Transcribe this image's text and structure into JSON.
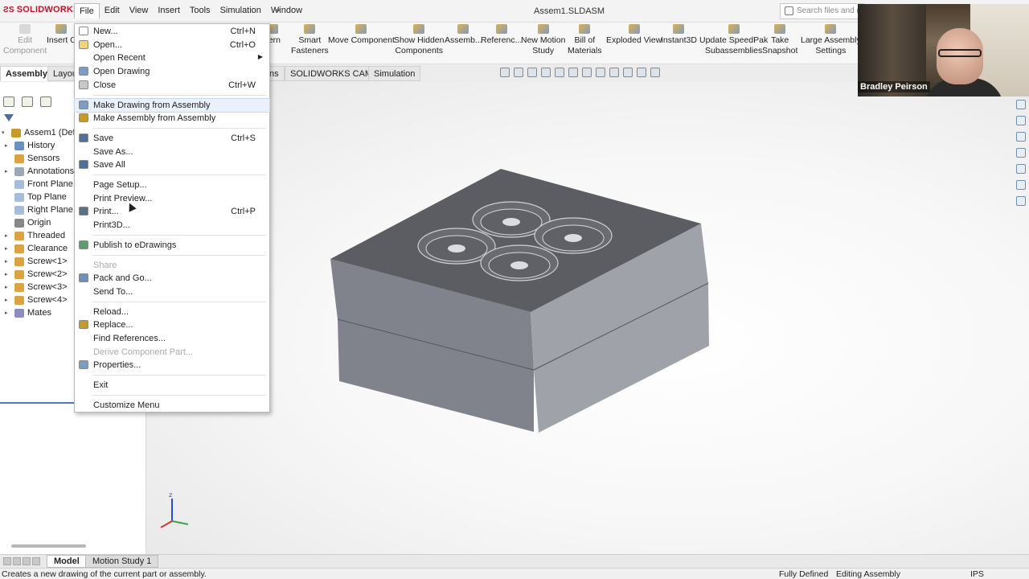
{
  "app": {
    "logo": "SOLIDWORKS",
    "doc_title": "Assem1.SLDASM",
    "search_placeholder": "Search files and models"
  },
  "menubar": [
    "File",
    "Edit",
    "View",
    "Insert",
    "Tools",
    "Simulation",
    "Window"
  ],
  "commands": [
    {
      "label": "Edit\nComponent",
      "disabled": true
    },
    {
      "label": "Insert C",
      "disabled": false
    },
    {
      "label": "ttern",
      "disabled": false
    },
    {
      "label": "Smart\nFasteners",
      "disabled": false
    },
    {
      "label": "Move Component",
      "disabled": false
    },
    {
      "label": "Show Hidden\nComponents",
      "disabled": false
    },
    {
      "label": "Assemb...",
      "disabled": false
    },
    {
      "label": "Referenc...",
      "disabled": false
    },
    {
      "label": "New Motion\nStudy",
      "disabled": false
    },
    {
      "label": "Bill of\nMaterials",
      "disabled": false
    },
    {
      "label": "Exploded View",
      "disabled": false
    },
    {
      "label": "Instant3D",
      "disabled": false
    },
    {
      "label": "Update SpeedPak\nSubassemblies",
      "disabled": false
    },
    {
      "label": "Take\nSnapshot",
      "disabled": false
    },
    {
      "label": "Large Assembly\nSettings",
      "disabled": false
    }
  ],
  "tabs": [
    "Assembly",
    "Layou",
    "ns",
    "SOLIDWORKS CAM",
    "Simulation"
  ],
  "tree": [
    {
      "label": "Assem1 (Defa",
      "expand": "▾",
      "color": "#c79a2a"
    },
    {
      "label": "History",
      "expand": "▸",
      "color": "#6b8fbf"
    },
    {
      "label": "Sensors",
      "expand": "",
      "color": "#d9a441"
    },
    {
      "label": "Annotations",
      "expand": "▸",
      "color": "#9aa7b5"
    },
    {
      "label": "Front Plane",
      "expand": "",
      "color": "#a7bcd6"
    },
    {
      "label": "Top Plane",
      "expand": "",
      "color": "#a7bcd6"
    },
    {
      "label": "Right Plane",
      "expand": "",
      "color": "#a7bcd6"
    },
    {
      "label": "Origin",
      "expand": "",
      "color": "#888888"
    },
    {
      "label": "Threaded",
      "expand": "▸",
      "color": "#d9a441"
    },
    {
      "label": "Clearance",
      "expand": "▸",
      "color": "#d9a441"
    },
    {
      "label": "Screw<1>",
      "expand": "▸",
      "color": "#d9a441"
    },
    {
      "label": "Screw<2>",
      "expand": "▸",
      "color": "#d9a441"
    },
    {
      "label": "Screw<3>",
      "expand": "▸",
      "color": "#d9a441"
    },
    {
      "label": "Screw<4>",
      "expand": "▸",
      "color": "#d9a441"
    },
    {
      "label": "Mates",
      "expand": "▸",
      "color": "#8c8cbf"
    }
  ],
  "file_menu": [
    {
      "label": "New...",
      "shortcut": "Ctrl+N",
      "icon": true,
      "color": "#ffffff"
    },
    {
      "label": "Open...",
      "shortcut": "Ctrl+O",
      "icon": true,
      "color": "#f3d27a"
    },
    {
      "label": "Open Recent",
      "shortcut": "",
      "arrow": true,
      "icon": false
    },
    {
      "label": "Open Drawing",
      "shortcut": "",
      "icon": true,
      "color": "#7d9cc4"
    },
    {
      "label": "Close",
      "shortcut": "Ctrl+W",
      "icon": true,
      "color": "#c8c8c8"
    },
    {
      "sep": true
    },
    {
      "label": "Make Drawing from Assembly",
      "shortcut": "",
      "icon": true,
      "color": "#7d9cc4",
      "highlight": true
    },
    {
      "label": "Make Assembly from Assembly",
      "shortcut": "",
      "icon": true,
      "color": "#c79a2a"
    },
    {
      "sep": true
    },
    {
      "label": "Save",
      "shortcut": "Ctrl+S",
      "icon": true,
      "color": "#4f6f9a"
    },
    {
      "label": "Save As...",
      "shortcut": "",
      "icon": false
    },
    {
      "label": "Save All",
      "shortcut": "",
      "icon": true,
      "color": "#4f6f9a"
    },
    {
      "sep": true
    },
    {
      "label": "Page Setup...",
      "shortcut": "",
      "icon": false
    },
    {
      "label": "Print Preview...",
      "shortcut": "",
      "icon": false
    },
    {
      "label": "Print...",
      "shortcut": "Ctrl+P",
      "icon": true,
      "color": "#5d6f85"
    },
    {
      "label": "Print3D...",
      "shortcut": "",
      "icon": false
    },
    {
      "sep": true
    },
    {
      "label": "Publish to eDrawings",
      "shortcut": "",
      "icon": true,
      "color": "#5e9c6a"
    },
    {
      "sep": true
    },
    {
      "label": "Share",
      "shortcut": "",
      "icon": false,
      "disabled": true
    },
    {
      "label": "Pack and Go...",
      "shortcut": "",
      "icon": true,
      "color": "#6b8fbf"
    },
    {
      "label": "Send To...",
      "shortcut": "",
      "icon": false
    },
    {
      "sep": true
    },
    {
      "label": "Reload...",
      "shortcut": "",
      "icon": false
    },
    {
      "label": "Replace...",
      "shortcut": "",
      "icon": true,
      "color": "#c79a2a"
    },
    {
      "label": "Find References...",
      "shortcut": "",
      "icon": false
    },
    {
      "label": "Derive Component Part...",
      "shortcut": "",
      "icon": false,
      "disabled": true
    },
    {
      "label": "Properties...",
      "shortcut": "",
      "icon": true,
      "color": "#7d9cc4"
    },
    {
      "sep": true
    },
    {
      "label": "Exit",
      "shortcut": "",
      "icon": false
    },
    {
      "sep": true
    },
    {
      "label": "Customize Menu",
      "shortcut": "",
      "icon": false
    }
  ],
  "webcam": {
    "name": "Bradley Peirson"
  },
  "bottom_tabs": [
    "Model",
    "Motion Study 1"
  ],
  "status": {
    "message": "Creates a new drawing of the current part or assembly.",
    "state": "Fully Defined",
    "mode": "Editing Assembly",
    "units": "IPS"
  },
  "colors": {
    "accent": "#c8102e",
    "model_top": "#5c5d62",
    "model_side": "#8c8e96"
  }
}
